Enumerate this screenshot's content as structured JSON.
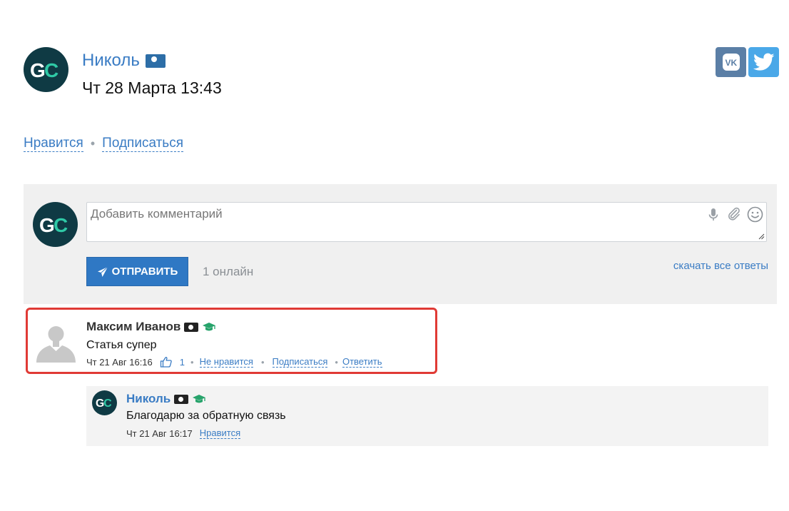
{
  "author": {
    "name": "Николь",
    "date": "Чт 28 Марта 13:43",
    "badge_icon": "money-icon",
    "avatar_text": "GC"
  },
  "social": {
    "vk_icon": "vk-icon",
    "vk_label": "VK",
    "twitter_icon": "twitter-icon"
  },
  "actions": {
    "like": "Нравится",
    "subscribe": "Подписаться"
  },
  "composer": {
    "placeholder": "Добавить комментарий",
    "send_label": "ОТПРАВИТЬ",
    "online": "1 онлайн",
    "download": "скачать все ответы"
  },
  "comments": [
    {
      "author": "Максим Иванов",
      "text": "Статья супер",
      "date": "Чт 21 Авг 16:16",
      "likes": "1",
      "dislike_label": "Не нравится",
      "subscribe_label": "Подписаться",
      "reply_label": "Ответить"
    }
  ],
  "replies": [
    {
      "author": "Николь",
      "text": "Благодарю за обратную связь",
      "date": "Чт 21 Авг 16:17",
      "like_label": "Нравится"
    }
  ],
  "colors": {
    "accent": "#3a7cc4",
    "button": "#2f78c4",
    "highlight_border": "#e03a35",
    "panel_bg": "#f0f0f0",
    "badge_green": "#27a36b"
  }
}
